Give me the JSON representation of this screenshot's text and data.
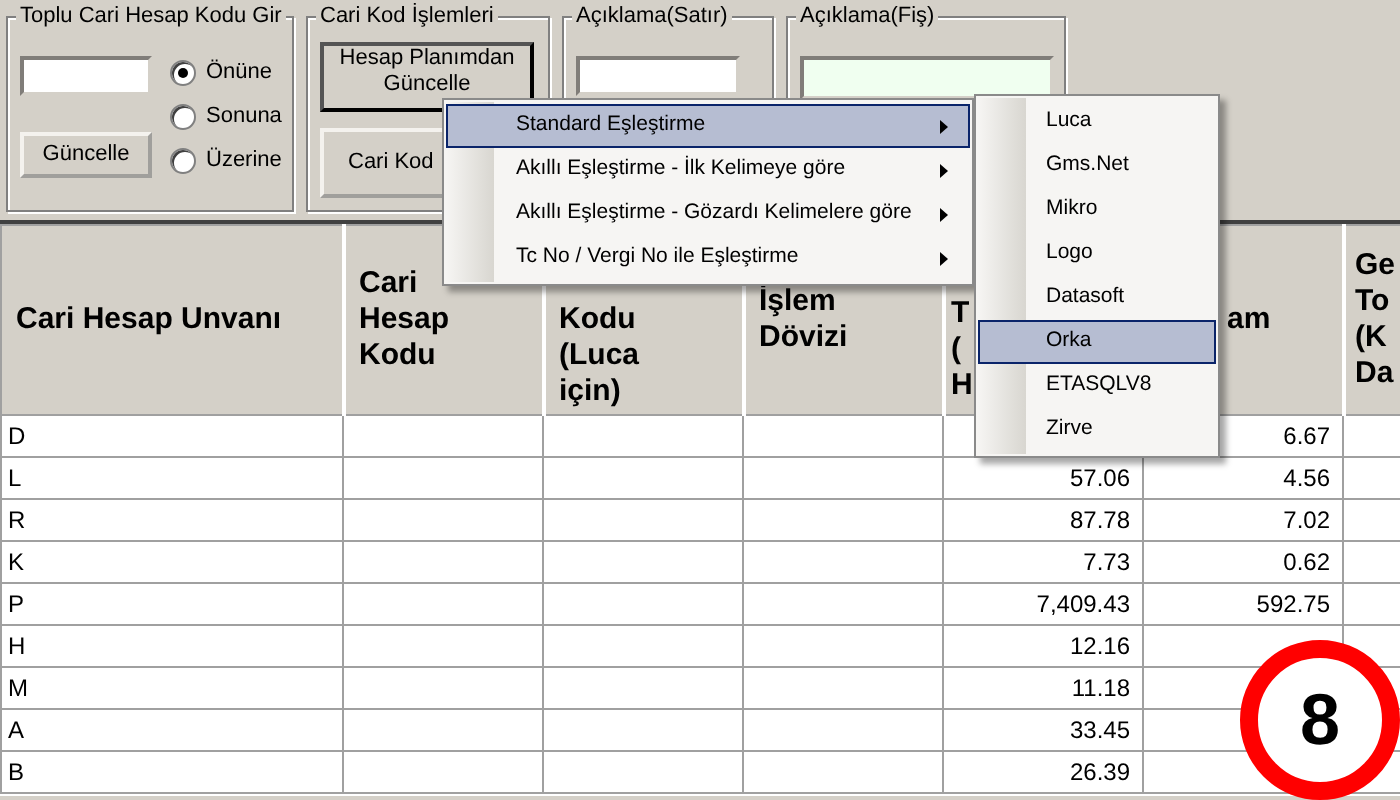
{
  "bulk_code": {
    "title": "Toplu Cari Hesap Kodu Gir",
    "radios": [
      {
        "label": "Önüne",
        "selected": true
      },
      {
        "label": "Sonuna",
        "selected": false
      },
      {
        "label": "Üzerine",
        "selected": false
      }
    ],
    "button": "Güncelle"
  },
  "code_ops": {
    "title": "Cari Kod İşlemleri",
    "buttons": [
      "Hesap Planımdan Güncelle",
      "Cari Kod"
    ]
  },
  "line_note": {
    "title": "Açıklama(Satır)"
  },
  "doc_note": {
    "title": "Açıklama(Fiş)"
  },
  "table": {
    "columns": [
      {
        "lines": [
          "Cari Hesap Unvanı"
        ]
      },
      {
        "lines": [
          "Cari",
          "Hesap",
          "Kodu"
        ]
      },
      {
        "lines": [
          "Kodu",
          "(Luca",
          "için)"
        ]
      },
      {
        "lines": [
          "İşlem",
          "Dövizi"
        ]
      },
      {
        "lines": [
          "T",
          "(",
          "H"
        ]
      },
      {
        "lines": [
          "am"
        ]
      },
      {
        "lines": [
          "Ge",
          "To",
          "(K",
          "Da"
        ]
      }
    ],
    "rows": [
      {
        "cells": [
          "D",
          null,
          null,
          null,
          null,
          "6.67",
          null
        ]
      },
      {
        "cells": [
          "L",
          null,
          null,
          null,
          "57.06",
          "4.56",
          null
        ]
      },
      {
        "cells": [
          "R",
          null,
          null,
          null,
          "87.78",
          "7.02",
          null
        ]
      },
      {
        "cells": [
          "K",
          null,
          null,
          null,
          "7.73",
          "0.62",
          null
        ]
      },
      {
        "cells": [
          "P",
          null,
          null,
          null,
          "7,409.43",
          "592.75",
          null
        ]
      },
      {
        "cells": [
          "H",
          null,
          null,
          null,
          "12.16",
          null,
          null
        ]
      },
      {
        "cells": [
          "M",
          null,
          null,
          null,
          "11.18",
          null,
          null
        ]
      },
      {
        "cells": [
          "A",
          null,
          null,
          null,
          "33.45",
          null,
          null
        ]
      },
      {
        "cells": [
          "B",
          null,
          null,
          null,
          "26.39",
          null,
          null
        ]
      }
    ]
  },
  "context_menu": {
    "items": [
      {
        "label": "Standard Eşleştirme",
        "selected": true,
        "has_submenu": true
      },
      {
        "label": "Akıllı Eşleştirme - İlk Kelimeye göre",
        "selected": false,
        "has_submenu": true
      },
      {
        "label": "Akıllı Eşleştirme - Gözardı Kelimelere göre",
        "selected": false,
        "has_submenu": true
      },
      {
        "label": "Tc No / Vergi No ile Eşleştirme",
        "selected": false,
        "has_submenu": true
      }
    ]
  },
  "submenu": {
    "items": [
      {
        "label": "Luca",
        "selected": false
      },
      {
        "label": "Gms.Net",
        "selected": false
      },
      {
        "label": "Mikro",
        "selected": false
      },
      {
        "label": "Logo",
        "selected": false
      },
      {
        "label": "Datasoft",
        "selected": false
      },
      {
        "label": "Orka",
        "selected": true
      },
      {
        "label": "ETASQLV8",
        "selected": false
      },
      {
        "label": "Zirve",
        "selected": false
      }
    ]
  },
  "step_badge": "8"
}
